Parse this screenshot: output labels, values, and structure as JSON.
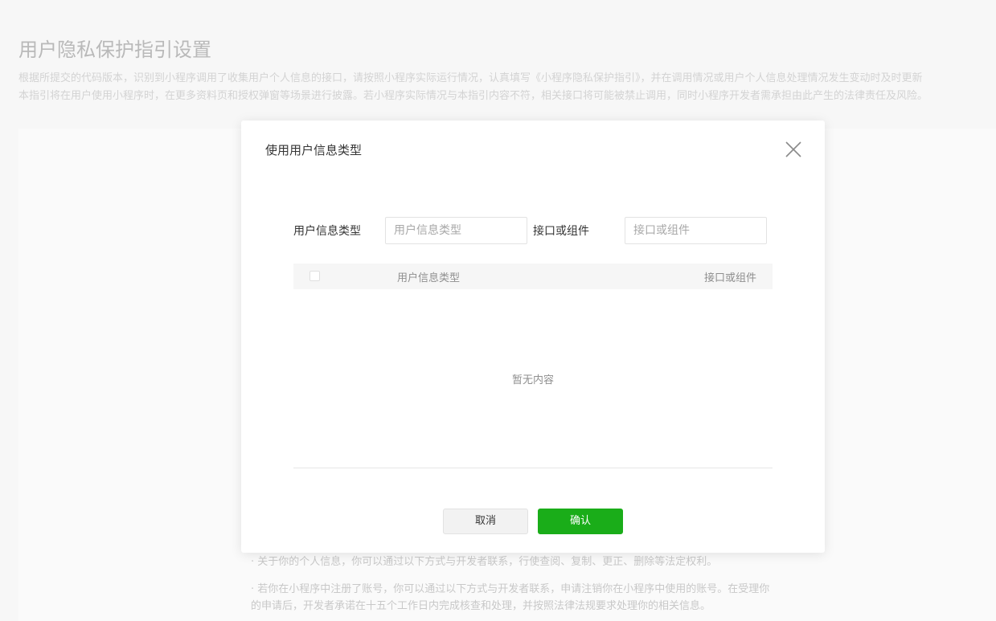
{
  "page": {
    "title": "用户隐私保护指引设置",
    "description_line1": "根据所提交的代码版本，识别到小程序调用了收集用户个人信息的接口，请按照小程序实际运行情况，认真填写《小程序隐私保护指引》，并在调用情况或用户个人信息处理情况发生变动时及时更新",
    "description_line2": "本指引将在用户使用小程序时，在更多资料页和授权弹窗等场景进行披露。若小程序实际情况与本指引内容不符，相关接口将可能被禁止调用，同时小程序开发者需承担由此产生的法律责任及风险。",
    "bullet1": "· 关于你的个人信息，你可以通过以下方式与开发者联系，行使查阅、复制、更正、删除等法定权利。",
    "bullet2_line1": "· 若你在小程序中注册了账号，你可以通过以下方式与开发者联系，申请注销你在小程序中使用的账号。在受理你",
    "bullet2_line2": "的申请后，开发者承诺在十五个工作日内完成核查和处理，并按照法律法规要求处理你的相关信息。"
  },
  "dialog": {
    "title": "使用用户信息类型",
    "close_icon": "close-icon",
    "filters": {
      "type_label": "用户信息类型",
      "type_placeholder": "用户信息类型",
      "type_value": "",
      "api_label": "接口或组件",
      "api_placeholder": "接口或组件",
      "api_value": ""
    },
    "table": {
      "columns": [
        "用户信息类型",
        "接口或组件"
      ],
      "rows": [],
      "empty_text": "暂无内容"
    },
    "buttons": {
      "cancel": "取消",
      "confirm": "确认"
    }
  },
  "colors": {
    "confirm_green": "#1aad19",
    "overlay_text": "#d3d3d3"
  }
}
